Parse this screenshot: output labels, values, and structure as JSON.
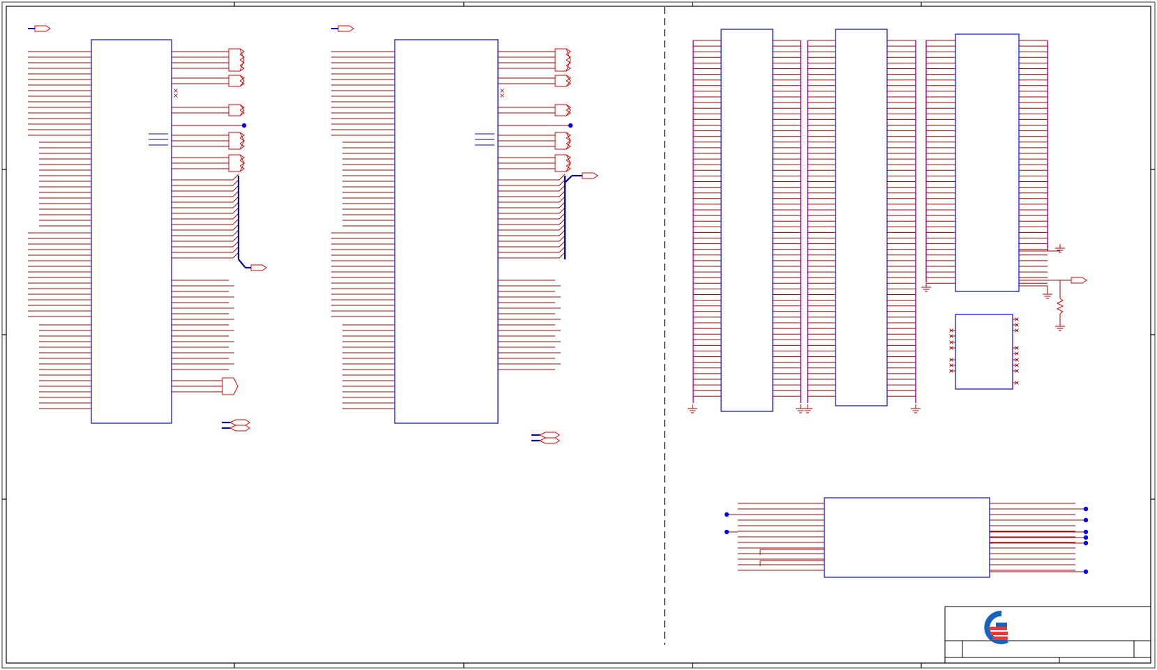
{
  "sheet": {
    "frame_color": "#000000",
    "component_color": "#0000ff",
    "wire_color": "#a00000",
    "bus_color": "#0000c0",
    "offpage_color": "#e00000",
    "magenta_color": "#c000c0",
    "dash_color": "#000000"
  },
  "title_block": {
    "logo_name": "quanta-logo-icon",
    "logo_blue": "#1565c0",
    "logo_red": "#e53935"
  }
}
